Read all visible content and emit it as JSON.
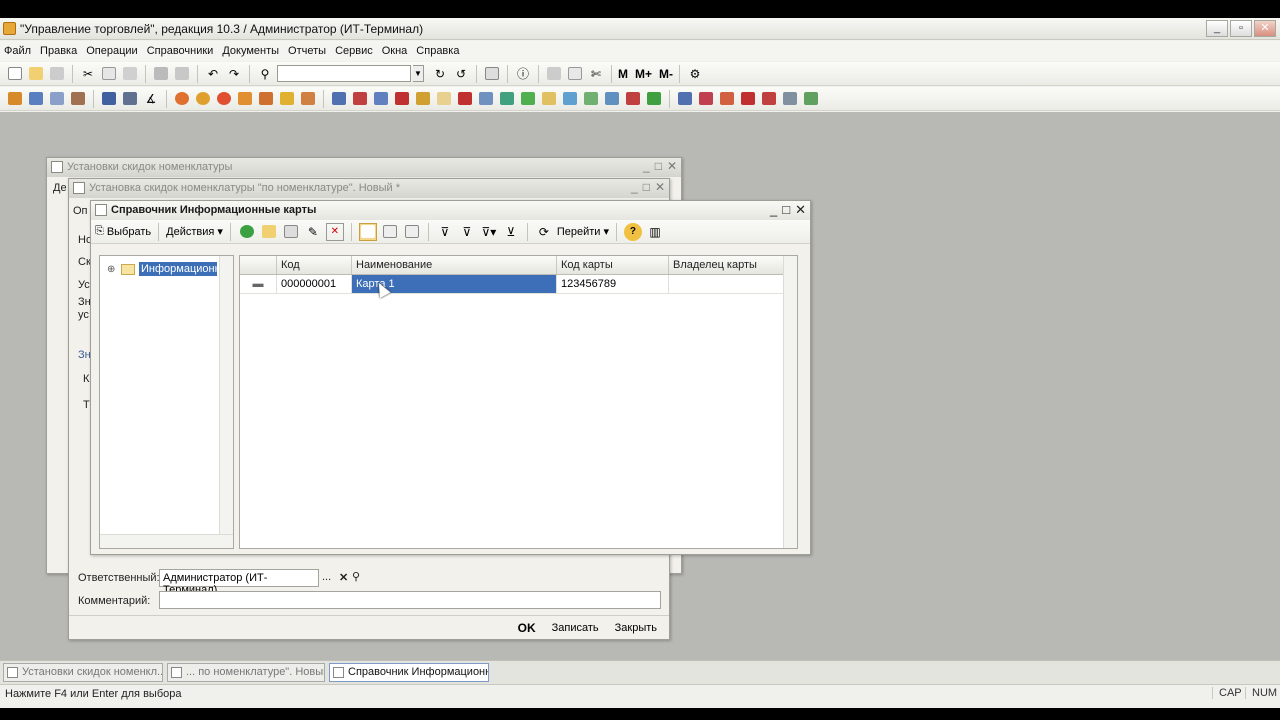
{
  "app": {
    "title": "\"Управление торговлей\", редакция 10.3 / Администратор (ИТ-Терминал)",
    "window_controls": [
      "_",
      "▫",
      "✕"
    ]
  },
  "menu": [
    "Файл",
    "Правка",
    "Операции",
    "Справочники",
    "Документы",
    "Отчеты",
    "Сервис",
    "Окна",
    "Справка"
  ],
  "toolbar1": {
    "zoom_buttons": [
      "M",
      "M+",
      "M-"
    ]
  },
  "bg_windows": {
    "win1_title": "Установки скидок номенклатуры",
    "win2_title": "Установка скидок номенклатуры \"по номенклатуре\". Новый *",
    "win1_tab": "Де",
    "win2_labels": [
      "Оп",
      "Но",
      "Ск",
      "Ус",
      "Зн",
      "ус",
      "Зн",
      "К",
      "Т"
    ],
    "responsible_label": "Ответственный:",
    "responsible_value": "Администратор (ИТ-Терминал)",
    "comment_label": "Комментарий:",
    "comment_value": "",
    "ok": "OK",
    "save": "Записать",
    "close": "Закрыть"
  },
  "catalog": {
    "title": "Справочник Информационные карты",
    "toolbar": {
      "select": "Выбрать",
      "actions": "Действия",
      "goto": "Перейти"
    },
    "tree": {
      "root_label": "Информационные карты"
    },
    "columns": [
      "Код",
      "Наименование",
      "Код карты",
      "Владелец карты"
    ],
    "rows": [
      {
        "code": "000000001",
        "name": "Карта 1",
        "card_code": "123456789",
        "owner": ""
      }
    ]
  },
  "taskbar": {
    "items": [
      "Установки скидок номенкл...",
      "... по номенклатуре\". Новый *",
      "Справочник Информационн..."
    ]
  },
  "status": {
    "hint": "Нажмите F4 или Enter для выбора",
    "cap": "CAP",
    "num": "NUM"
  }
}
